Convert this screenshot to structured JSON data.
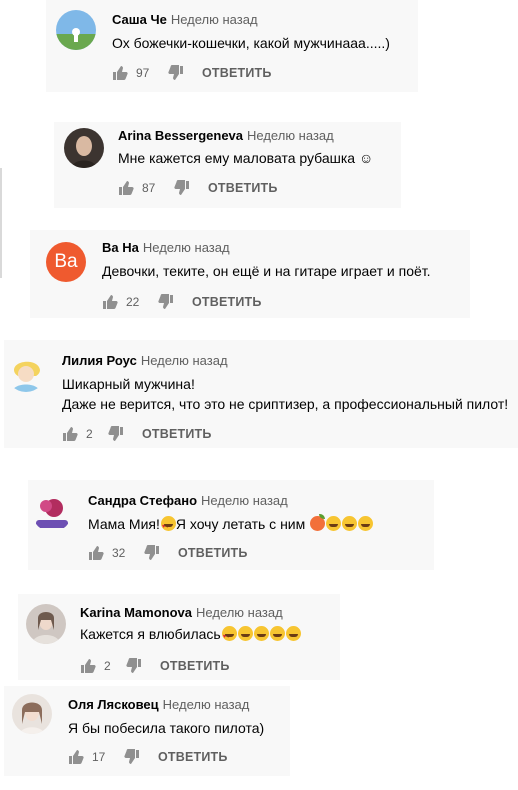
{
  "reply_label": "ОТВЕТИТЬ",
  "comments": [
    {
      "author": "Саша Че",
      "time": "Неделю назад",
      "lines": [
        "Ох божечки-кошечки, какой мужчинааа.....)"
      ],
      "likes": "97",
      "avatar_letter": "",
      "avatar_color": "#4a8fd1"
    },
    {
      "author": "Arina Bessergeneva",
      "time": "Неделю назад",
      "lines": [
        "Мне кажется ему маловата рубашка ☺"
      ],
      "likes": "87",
      "avatar_letter": "",
      "avatar_color": "#5a4a3a"
    },
    {
      "author": "Ва На",
      "time": "Неделю назад",
      "lines": [
        "Девочки, теките, он ещё и на гитаре играет и поёт."
      ],
      "likes": "22",
      "avatar_letter": "Ва",
      "avatar_color": "#ef5a2f"
    },
    {
      "author": "Лилия Роус",
      "time": "Неделю назад",
      "lines": [
        "Шикарный мужчина!",
        "Даже не верится, что это не сриптизер, а профессиональный пилот!"
      ],
      "likes": "2",
      "avatar_letter": "",
      "avatar_color": "#9fd3f0"
    },
    {
      "author": "Сандра Стефано",
      "time": "Неделю назад",
      "lines": [
        "Мама Мия!",
        "Я хочу летать с ним "
      ],
      "likes": "32",
      "avatar_letter": "",
      "avatar_color": "#b03a7a"
    },
    {
      "author": "Karina Mamonova",
      "time": "Неделю назад",
      "lines": [
        "Кажется я влюбилась"
      ],
      "likes": "2",
      "avatar_letter": "",
      "avatar_color": "#c9c2bd"
    },
    {
      "author": "Оля Лясковец",
      "time": "Неделю назад",
      "lines": [
        "Я бы побесила такого пилота)"
      ],
      "likes": "17",
      "avatar_letter": "",
      "avatar_color": "#d8cfc8"
    }
  ],
  "icons": {
    "like": "thumbs-up-icon",
    "dislike": "thumbs-down-icon"
  }
}
